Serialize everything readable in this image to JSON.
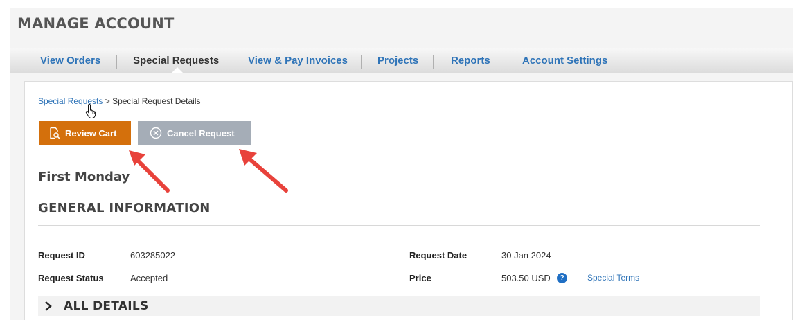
{
  "page": {
    "title": "MANAGE ACCOUNT"
  },
  "tabs": [
    {
      "label": "View Orders",
      "active": false
    },
    {
      "label": "Special Requests",
      "active": true
    },
    {
      "label": "View & Pay Invoices",
      "active": false
    },
    {
      "label": "Projects",
      "active": false
    },
    {
      "label": "Reports",
      "active": false
    },
    {
      "label": "Account Settings",
      "active": false
    }
  ],
  "breadcrumb": {
    "parent": "Special Requests",
    "separator": " > ",
    "current": "Special Request Details"
  },
  "actions": {
    "review_cart": "Review Cart",
    "cancel_request": "Cancel Request"
  },
  "request": {
    "name": "First Monday",
    "section_title": "GENERAL INFORMATION",
    "fields": {
      "request_id_label": "Request ID",
      "request_id": "603285022",
      "request_status_label": "Request Status",
      "request_status": "Accepted",
      "request_date_label": "Request Date",
      "request_date": "30 Jan 2024",
      "price_label": "Price",
      "price": "503.50 USD",
      "help_icon": "?",
      "special_terms": "Special Terms"
    },
    "all_details": "ALL DETAILS"
  },
  "colors": {
    "link": "#2f74b8",
    "review_button": "#d4700c",
    "cancel_button": "#a5adb7",
    "annotation_arrow": "#e8423b"
  },
  "icons": {
    "review_cart": "document-search-icon",
    "cancel_request": "circle-x-icon",
    "cursor": "hand-pointer-icon",
    "expand": "chevron-right-icon"
  }
}
